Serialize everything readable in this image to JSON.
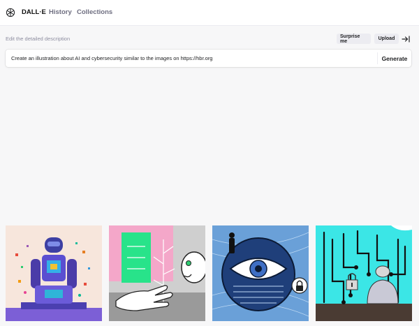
{
  "header": {
    "brand": "DALL·E",
    "nav": [
      "History",
      "Collections"
    ]
  },
  "prompt": {
    "hint": "Edit the detailed description",
    "value": "Create an illustration about AI and cybersecurity similar to the images on https://hbr.org",
    "surprise_label": "Surprise me",
    "upload_label": "Upload",
    "generate_label": "Generate"
  },
  "icons": {
    "logo": "openai-logo-icon",
    "collapse": "collapse-panel-icon"
  },
  "colors": {
    "background": "#f7f7f8",
    "surface": "#ffffff",
    "pill": "#ececf1",
    "muted_text": "#6e6e80"
  }
}
